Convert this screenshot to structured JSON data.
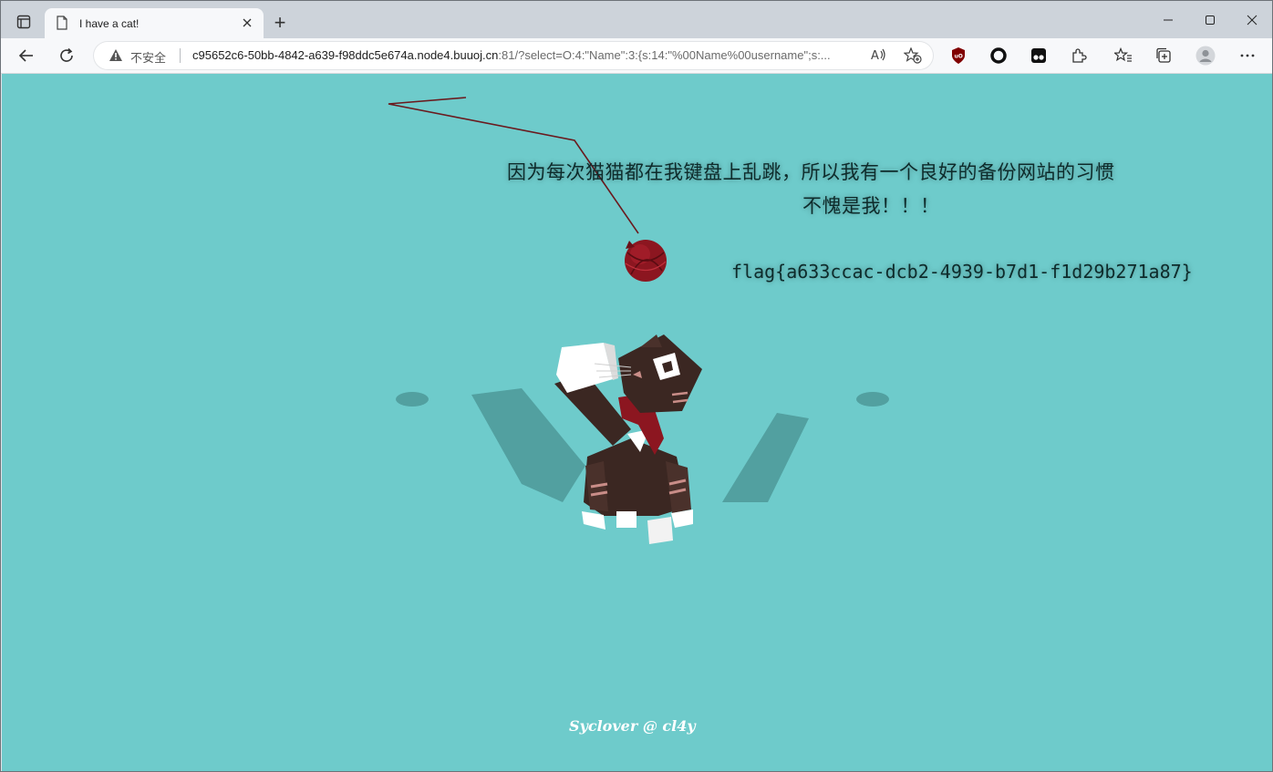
{
  "tab": {
    "title": "I have a cat!",
    "new_tab_symbol": "+"
  },
  "address_bar": {
    "security_label": "不安全",
    "url_host": "c95652c6-50bb-4842-a639-f98ddc5e674a.node4.buuoj.cn",
    "url_rest": ":81/?select=O:4:\"Name\":3:{s:14:\"%00Name%00username\";s:..."
  },
  "page": {
    "message_line1": "因为每次猫猫都在我键盘上乱跳，所以我有一个良好的备份网站的习惯",
    "message_line2": "不愧是我！！！",
    "flag": "flag{a633ccac-dcb2-4939-b7d1-f1d29b271a87}",
    "footer": "Syclover @ cl4y"
  },
  "colors": {
    "page_background": "#6ecbcb",
    "tabstrip": "#cdd3da",
    "toolbar": "#f7f8fa"
  },
  "icons": [
    "sidebar-icon",
    "page-icon",
    "close-icon",
    "minimize-icon",
    "maximize-icon",
    "back-icon",
    "reload-icon",
    "warning-icon",
    "read-aloud-icon",
    "add-favorite-icon",
    "ublock-icon",
    "circle-extension-icon",
    "tampermonkey-icon",
    "extensions-icon",
    "favorites-icon",
    "collections-icon",
    "profile-icon",
    "more-icon"
  ]
}
